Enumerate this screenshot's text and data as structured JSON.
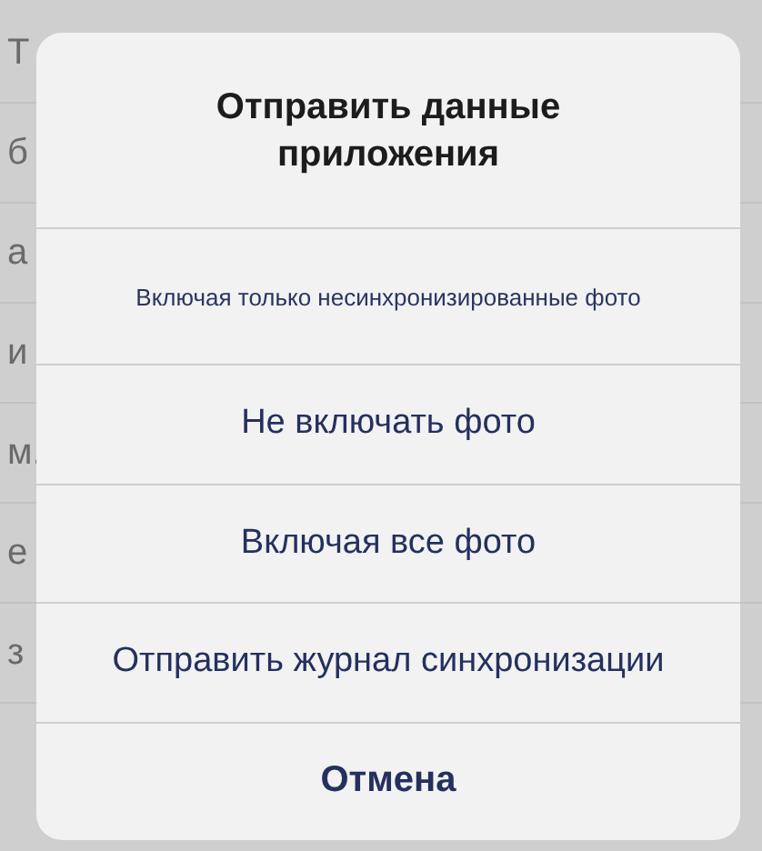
{
  "background_rows": [
    "Т",
    "б",
    "а",
    "и",
    "м.",
    "е",
    "з"
  ],
  "action_sheet": {
    "title": "Отправить данные приложения",
    "message": "Включая только несинхронизированные фото",
    "actions": [
      {
        "label": "Не включать фото",
        "kind": "action"
      },
      {
        "label": "Включая все фото",
        "kind": "action"
      },
      {
        "label": "Отправить журнал синхронизации",
        "kind": "action"
      },
      {
        "label": "Отмена",
        "kind": "cancel"
      }
    ]
  }
}
